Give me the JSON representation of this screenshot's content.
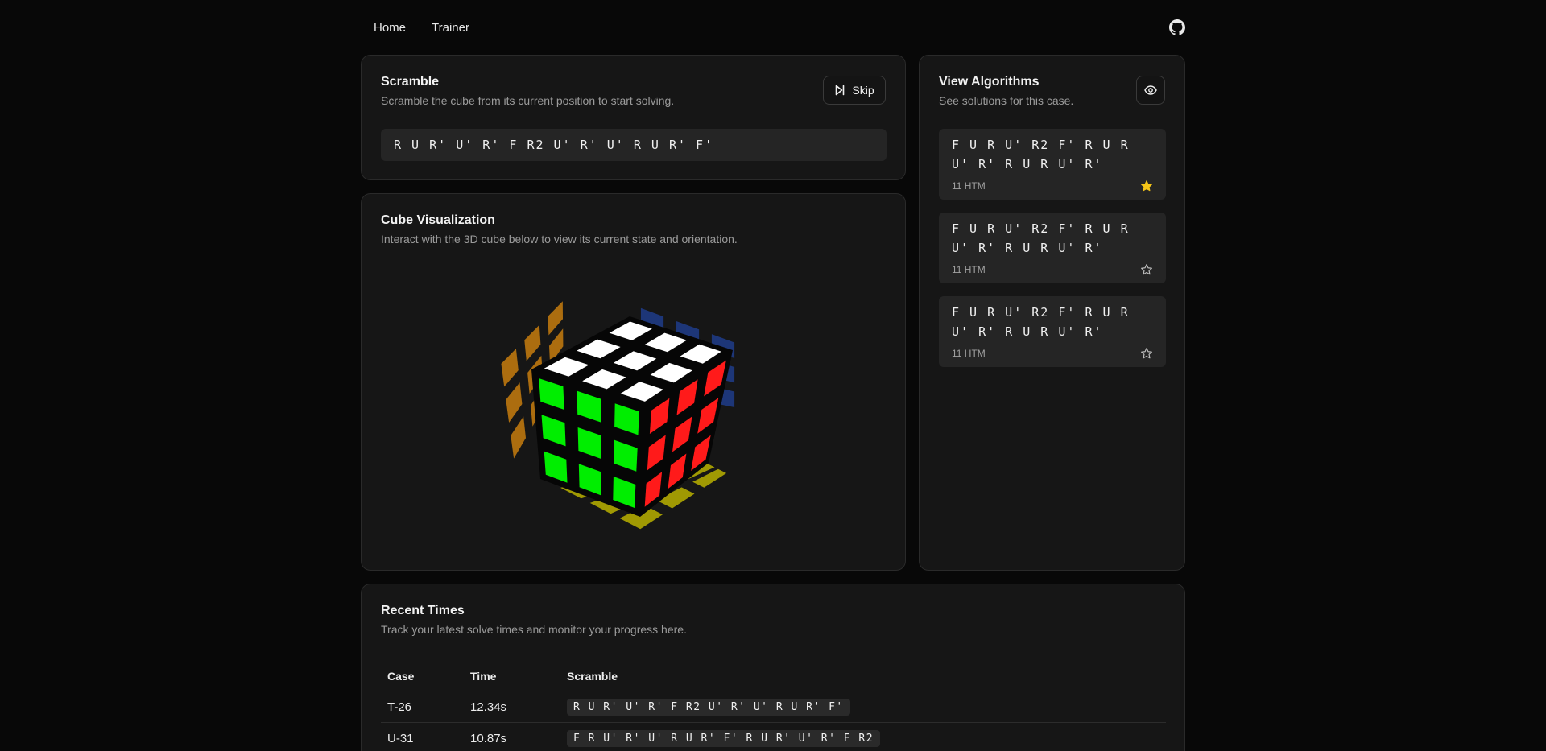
{
  "nav": {
    "items": [
      "Home",
      "Trainer"
    ],
    "github_icon": "github-icon"
  },
  "scramble": {
    "title": "Scramble",
    "description": "Scramble the cube from its current position to start solving.",
    "skip_label": "Skip",
    "skip_icon": "skip-forward-icon",
    "value": "R U R' U' R' F R2 U' R' U' R U R' F'"
  },
  "cube": {
    "title": "Cube Visualization",
    "description": "Interact with the 3D cube below to view its current state and orientation.",
    "colors": {
      "top": "#ffffff",
      "front": "#00ee00",
      "right": "#ff1a1a",
      "left_ghost": "#c77c0e",
      "back_ghost": "#1f3c8a",
      "bottom_ghost": "#b8b000"
    }
  },
  "algorithms": {
    "title": "View Algorithms",
    "description": "See solutions for this case.",
    "eye_icon": "eye-icon",
    "items": [
      {
        "moves": "F U R U' R2 F' R U R U' R' R U R U' R'",
        "htm": "11 HTM",
        "starred": true
      },
      {
        "moves": "F U R U' R2 F' R U R U' R' R U R U' R'",
        "htm": "11 HTM",
        "starred": false
      },
      {
        "moves": "F U R U' R2 F' R U R U' R' R U R U' R'",
        "htm": "11 HTM",
        "starred": false
      }
    ],
    "star_color": "#f5c518"
  },
  "times": {
    "title": "Recent Times",
    "description": "Track your latest solve times and monitor your progress here.",
    "columns": [
      "Case",
      "Time",
      "Scramble"
    ],
    "rows": [
      {
        "case": "T-26",
        "time": "12.34s",
        "scramble": "R U R' U' R' F R2 U' R' U' R U R' F'"
      },
      {
        "case": "U-31",
        "time": "10.87s",
        "scramble": "F R U' R' U' R U R' F' R U R' U' R' F R2"
      }
    ]
  }
}
